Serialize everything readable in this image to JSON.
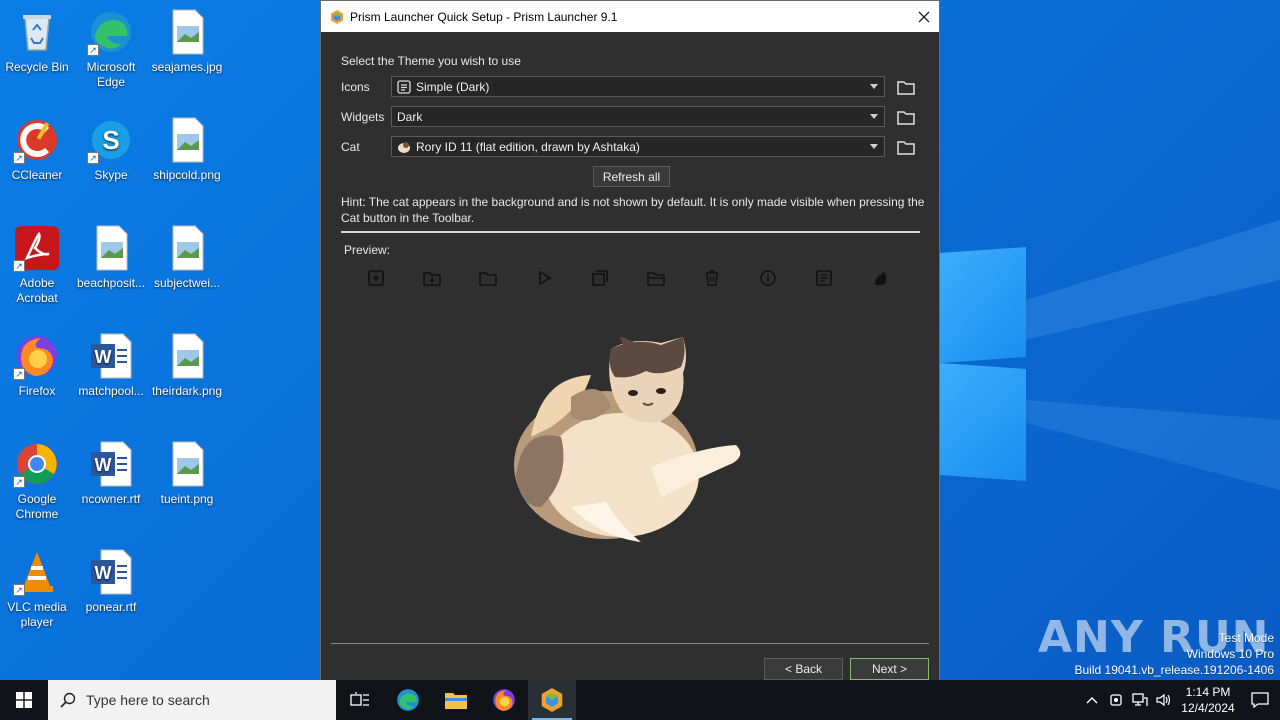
{
  "desktop": {
    "icons": [
      {
        "label": "Recycle Bin"
      },
      {
        "label": "Microsoft Edge"
      },
      {
        "label": "seajames.jpg"
      },
      {
        "label": "CCleaner"
      },
      {
        "label": "Skype"
      },
      {
        "label": "shipcold.png"
      },
      {
        "label": "Adobe Acrobat"
      },
      {
        "label": "beachposit..."
      },
      {
        "label": "subjectwei..."
      },
      {
        "label": "Firefox"
      },
      {
        "label": "matchpool..."
      },
      {
        "label": "theirdark.png"
      },
      {
        "label": "Google Chrome"
      },
      {
        "label": "ncowner.rtf"
      },
      {
        "label": "tueint.png"
      },
      {
        "label": "VLC media player"
      },
      {
        "label": "ponear.rtf"
      }
    ]
  },
  "dialog": {
    "title": "Prism Launcher Quick Setup - Prism Launcher 9.1",
    "section_label": "Select the Theme you wish to use",
    "icons_label": "Icons",
    "icons_value": "Simple (Dark)",
    "widgets_label": "Widgets",
    "widgets_value": "Dark",
    "cat_label": "Cat",
    "cat_value": "Rory ID 11 (flat edition, drawn by Ashtaka)",
    "refresh_label": "Refresh all",
    "hint": "Hint: The cat appears in the background and is not shown by default. It is only made visible when pressing the Cat button in the Toolbar.",
    "preview_label": "Preview:",
    "preview_icons": [
      "new-instance-icon",
      "import-icon",
      "folder-icon",
      "launch-icon",
      "copy-icon",
      "instance-folder-icon",
      "delete-icon",
      "about-icon",
      "news-icon",
      "cat-icon"
    ],
    "back_label": "< Back",
    "next_label": "Next >"
  },
  "taskbar": {
    "search_placeholder": "Type here to search",
    "time": "1:14 PM",
    "date": "12/4/2024"
  },
  "watermark": {
    "line1": "Test Mode",
    "line2": "Windows 10 Pro",
    "line3": "Build 19041.vb_release.191206-1406",
    "brand": "ANY RUN"
  }
}
